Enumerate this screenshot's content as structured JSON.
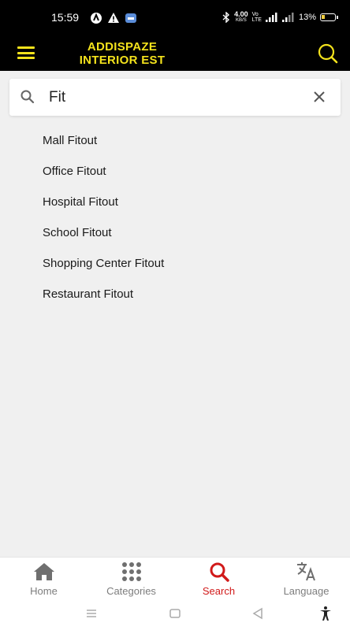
{
  "status_bar": {
    "time": "15:59",
    "speed": "4.00",
    "speed_unit": "KB/S",
    "battery": "13%"
  },
  "app_bar": {
    "title_line1": "ADDISPAZE",
    "title_line2": "INTERIOR EST",
    "accent_color": "#f3e21c"
  },
  "search": {
    "value": "Fit",
    "placeholder": ""
  },
  "suggestions": [
    "Mall Fitout",
    "Office Fitout",
    "Hospital Fitout",
    "School Fitout",
    "Shopping Center Fitout",
    "Restaurant Fitout"
  ],
  "bottom_nav": {
    "home": "Home",
    "categories": "Categories",
    "search": "Search",
    "language": "Language",
    "active_color": "#d11a1a"
  },
  "icons": {
    "menu": "hamburger-menu-icon",
    "search": "magnifier-icon",
    "clear": "close-icon",
    "home": "house-icon",
    "categories": "grid-dots-icon",
    "language": "translate-icon"
  }
}
